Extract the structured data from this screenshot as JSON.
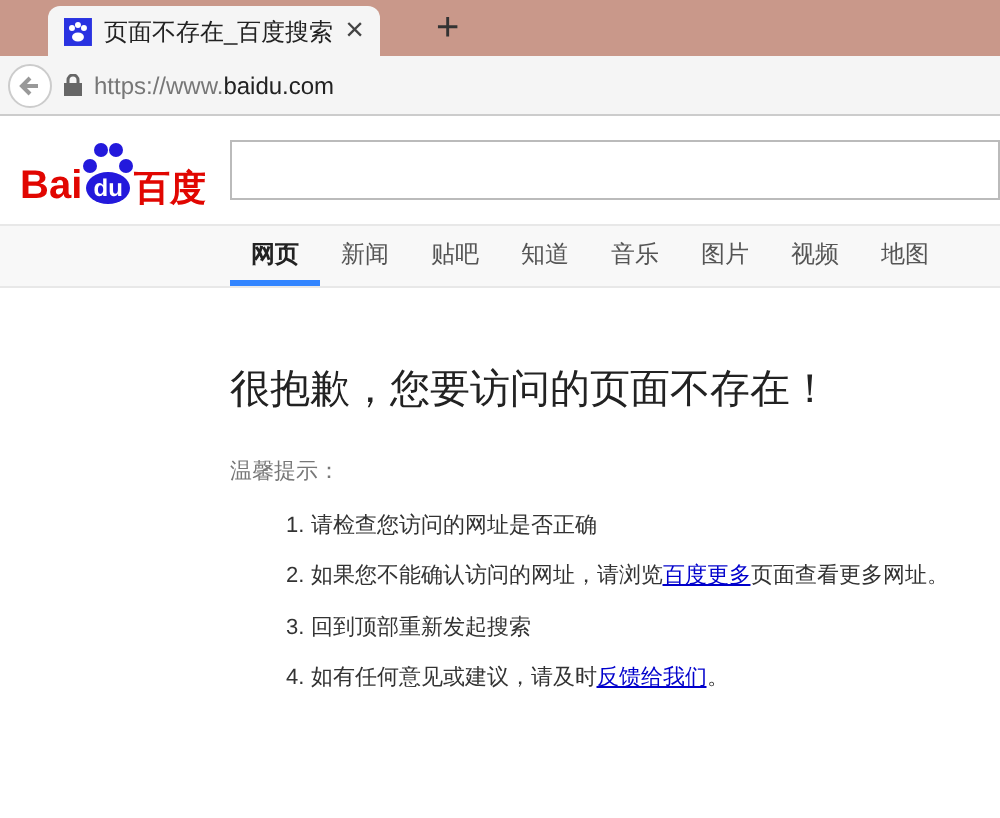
{
  "browser": {
    "tab_title": "页面不存在_百度搜索",
    "tab_close": "×",
    "new_tab": "+",
    "url_scheme": "https://www.",
    "url_domain": "baidu.com"
  },
  "logo": {
    "part_1": "Bai",
    "part_2": "du",
    "part_3": "百度"
  },
  "nav": [
    {
      "label": "网页",
      "selected": true
    },
    {
      "label": "新闻",
      "selected": false
    },
    {
      "label": "贴吧",
      "selected": false
    },
    {
      "label": "知道",
      "selected": false
    },
    {
      "label": "音乐",
      "selected": false
    },
    {
      "label": "图片",
      "selected": false
    },
    {
      "label": "视频",
      "selected": false
    },
    {
      "label": "地图",
      "selected": false
    }
  ],
  "error": {
    "title": "很抱歉，您要访问的页面不存在！",
    "hint_label": "温馨提示：",
    "tips": [
      {
        "number": "1.",
        "text": "请检查您访问的网址是否正确"
      },
      {
        "number": "2.",
        "text": "如果您不能确认访问的网址，请浏览",
        "link": "百度更多",
        "after": "页面查看更多网址。"
      },
      {
        "number": "3.",
        "text": "回到顶部重新发起搜索"
      },
      {
        "number": "4.",
        "text": "如有任何意见或建议，请及时",
        "link": "反馈给我们",
        "after": "。"
      }
    ]
  }
}
